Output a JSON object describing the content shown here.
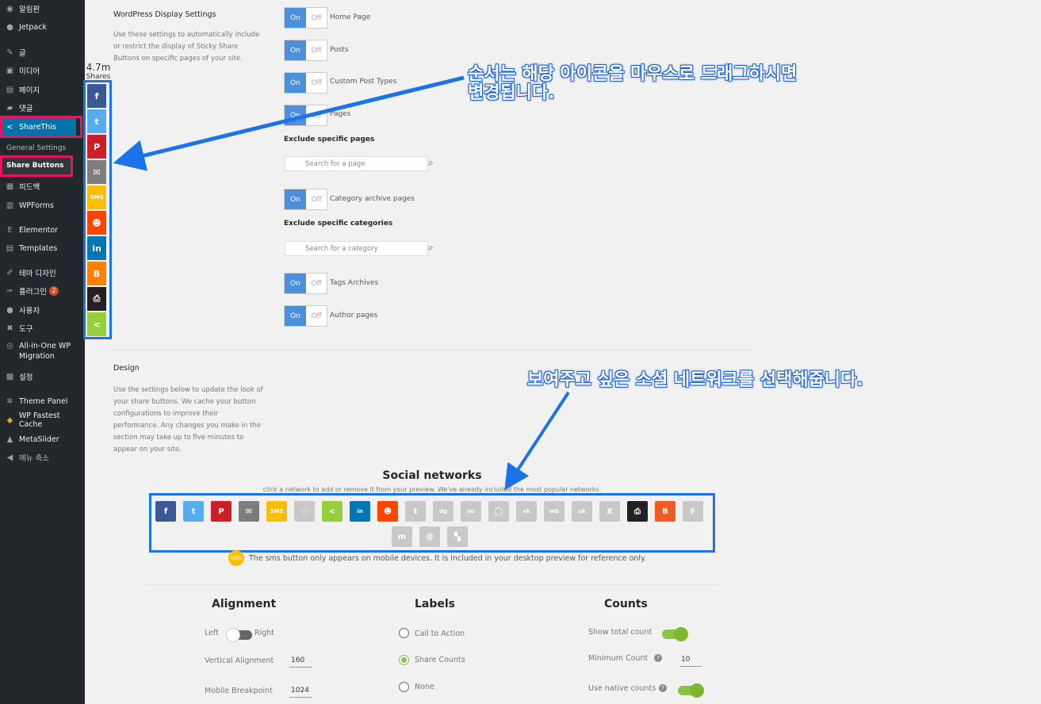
{
  "sidebar": {
    "items": [
      {
        "label": "알림판",
        "icon": "dashboard-icon",
        "glyph": "◉"
      },
      {
        "label": "Jetpack",
        "icon": "jetpack-icon",
        "glyph": "●"
      },
      {
        "label": "글",
        "icon": "pin-icon",
        "glyph": "✎"
      },
      {
        "label": "미디어",
        "icon": "media-icon",
        "glyph": "▣"
      },
      {
        "label": "페이지",
        "icon": "page-icon",
        "glyph": "▤"
      },
      {
        "label": "댓글",
        "icon": "comment-icon",
        "glyph": "▰"
      },
      {
        "label": "ShareThis",
        "icon": "share-icon",
        "glyph": "<"
      },
      {
        "label": "피드백",
        "icon": "feedback-icon",
        "glyph": "▦"
      },
      {
        "label": "WPForms",
        "icon": "wpforms-icon",
        "glyph": "▥"
      },
      {
        "label": "Elementor",
        "icon": "elementor-icon",
        "glyph": "E"
      },
      {
        "label": "Templates",
        "icon": "templates-icon",
        "glyph": "▤"
      },
      {
        "label": "테마 디자인",
        "icon": "brush-icon",
        "glyph": "✐"
      },
      {
        "label": "플러그인",
        "icon": "plugin-icon",
        "glyph": "✑",
        "badge": "2"
      },
      {
        "label": "사용자",
        "icon": "user-icon",
        "glyph": "●"
      },
      {
        "label": "도구",
        "icon": "tools-icon",
        "glyph": "✖"
      },
      {
        "label": "All-in-One WP Migration",
        "icon": "migration-icon",
        "glyph": "◎"
      },
      {
        "label": "설정",
        "icon": "settings-icon",
        "glyph": "▩"
      },
      {
        "label": "Theme Panel",
        "icon": "gear-icon",
        "glyph": "✲"
      },
      {
        "label": "WP Fastest Cache",
        "icon": "cheetah-icon",
        "glyph": "◆"
      },
      {
        "label": "MetaSlider",
        "icon": "metaslider-icon",
        "glyph": "▲"
      },
      {
        "label": "메뉴 축소",
        "icon": "collapse-icon",
        "glyph": "◀"
      }
    ],
    "submenu_label": "General Settings",
    "submenu_current": "Share Buttons"
  },
  "sticky": {
    "count": "4.7m",
    "count_label": "Shares",
    "buttons": [
      {
        "icon": "facebook-icon",
        "glyph": "f",
        "color": "#3b5998"
      },
      {
        "icon": "twitter-icon",
        "glyph": "t",
        "color": "#55acee"
      },
      {
        "icon": "pinterest-icon",
        "glyph": "P",
        "color": "#cb2027"
      },
      {
        "icon": "email-icon",
        "glyph": "✉",
        "color": "#7d7d7d"
      },
      {
        "icon": "sms-icon",
        "glyph": "SMS",
        "color": "#ffbd00"
      },
      {
        "icon": "reddit-icon",
        "glyph": "☻",
        "color": "#ff4500"
      },
      {
        "icon": "linkedin-icon",
        "glyph": "in",
        "color": "#0077b5"
      },
      {
        "icon": "blogger-icon",
        "glyph": "B",
        "color": "#ff8000"
      },
      {
        "icon": "print-icon",
        "glyph": "⎙",
        "color": "#222222"
      },
      {
        "icon": "sharethis-icon",
        "glyph": "<",
        "color": "#95d03a"
      }
    ]
  },
  "display": {
    "title": "WordPress Display Settings",
    "description": "Use these settings to automatically include or restrict the display of Sticky Share Buttons on specific pages of your site.",
    "on": "On",
    "off": "Off",
    "toggles": {
      "home": "Home Page",
      "posts": "Posts",
      "custom": "Custom Post Types",
      "pages": "Pages",
      "category": "Category archive pages",
      "tags": "Tags Archives",
      "author": "Author pages"
    },
    "exclude_pages": "Exclude specific pages",
    "search_page_placeholder": "Search for a page",
    "exclude_categories": "Exclude specific categories",
    "search_category_placeholder": "Search for a category"
  },
  "annotations": {
    "drag_line1": "순서는 해당 아이콘을 마우스로 드래그하시면",
    "drag_line2": "변경됩니다.",
    "select_networks": "보여주고 싶은 소셜 네트워크를 선택해줍니다."
  },
  "design": {
    "title": "Design",
    "description": "Use the settings below to update the look of your share buttons. We cache your button configurations to improve their performance. Any changes you make in the section may take up to five minutes to appear on your site."
  },
  "networks": {
    "title": "Social networks",
    "subtitle": "click a network to add or remove it from your preview. We've already included the most popular networks.",
    "items": [
      {
        "icon": "facebook-icon",
        "glyph": "f",
        "color": "#3b5998"
      },
      {
        "icon": "twitter-icon",
        "glyph": "t",
        "color": "#55acee"
      },
      {
        "icon": "pinterest-icon",
        "glyph": "P",
        "color": "#cb2027"
      },
      {
        "icon": "email-icon",
        "glyph": "✉",
        "color": "#7d7d7d"
      },
      {
        "icon": "sms-icon",
        "glyph": "SMS",
        "color": "#ffbd00"
      },
      {
        "icon": "messenger-icon",
        "glyph": "◌",
        "color": "#c8c8c8"
      },
      {
        "icon": "sharethis-icon",
        "glyph": "<",
        "color": "#95d03a"
      },
      {
        "icon": "linkedin-icon",
        "glyph": "in",
        "color": "#0077b5"
      },
      {
        "icon": "reddit-icon",
        "glyph": "☻",
        "color": "#ff4500"
      },
      {
        "icon": "tumblr-icon",
        "glyph": "t",
        "color": "#c8c8c8"
      },
      {
        "icon": "digg-icon",
        "glyph": "dg",
        "color": "#c8c8c8"
      },
      {
        "icon": "stumbleupon-icon",
        "glyph": "su",
        "color": "#c8c8c8"
      },
      {
        "icon": "whatsapp-icon",
        "glyph": "◯",
        "color": "#c8c8c8"
      },
      {
        "icon": "vk-icon",
        "glyph": "vk",
        "color": "#c8c8c8"
      },
      {
        "icon": "weibo-icon",
        "glyph": "wb",
        "color": "#c8c8c8"
      },
      {
        "icon": "odnoklassniki-icon",
        "glyph": "ok",
        "color": "#c8c8c8"
      },
      {
        "icon": "xing-icon",
        "glyph": "X",
        "color": "#c8c8c8"
      },
      {
        "icon": "print-icon",
        "glyph": "⎙",
        "color": "#222222"
      },
      {
        "icon": "blogger-icon",
        "glyph": "B",
        "color": "#f15a24"
      },
      {
        "icon": "flipboard-icon",
        "glyph": "F",
        "color": "#c8c8c8"
      },
      {
        "icon": "meneame-icon",
        "glyph": "m",
        "color": "#c8c8c8"
      },
      {
        "icon": "mailru-icon",
        "glyph": "@",
        "color": "#c8c8c8"
      },
      {
        "icon": "delicious-icon",
        "glyph": "▚",
        "color": "#c8c8c8"
      }
    ],
    "sms_note": "The sms button only appears on mobile devices. It is included in your desktop preview for reference only.",
    "sms_badge": "SMS"
  },
  "alignment": {
    "title": "Alignment",
    "left": "Left",
    "right": "Right",
    "vertical_label": "Vertical Alignment",
    "vertical_value": "160",
    "breakpoint_label": "Mobile Breakpoint",
    "breakpoint_value": "1024"
  },
  "labels": {
    "title": "Labels",
    "options": [
      "Call to Action",
      "Share Counts",
      "None"
    ],
    "selected": 1
  },
  "counts": {
    "title": "Counts",
    "show_total": "Show total count",
    "minimum": "Minimum Count",
    "minimum_value": "10",
    "native": "Use native counts",
    "help_glyph": "?"
  },
  "colors": {
    "accent": "#0073aa",
    "toggle_on": "#4c8fdb",
    "switch_green": "#8bc34a",
    "highlight_blue": "#1a73e8",
    "highlight_pink": "#e8175d"
  }
}
